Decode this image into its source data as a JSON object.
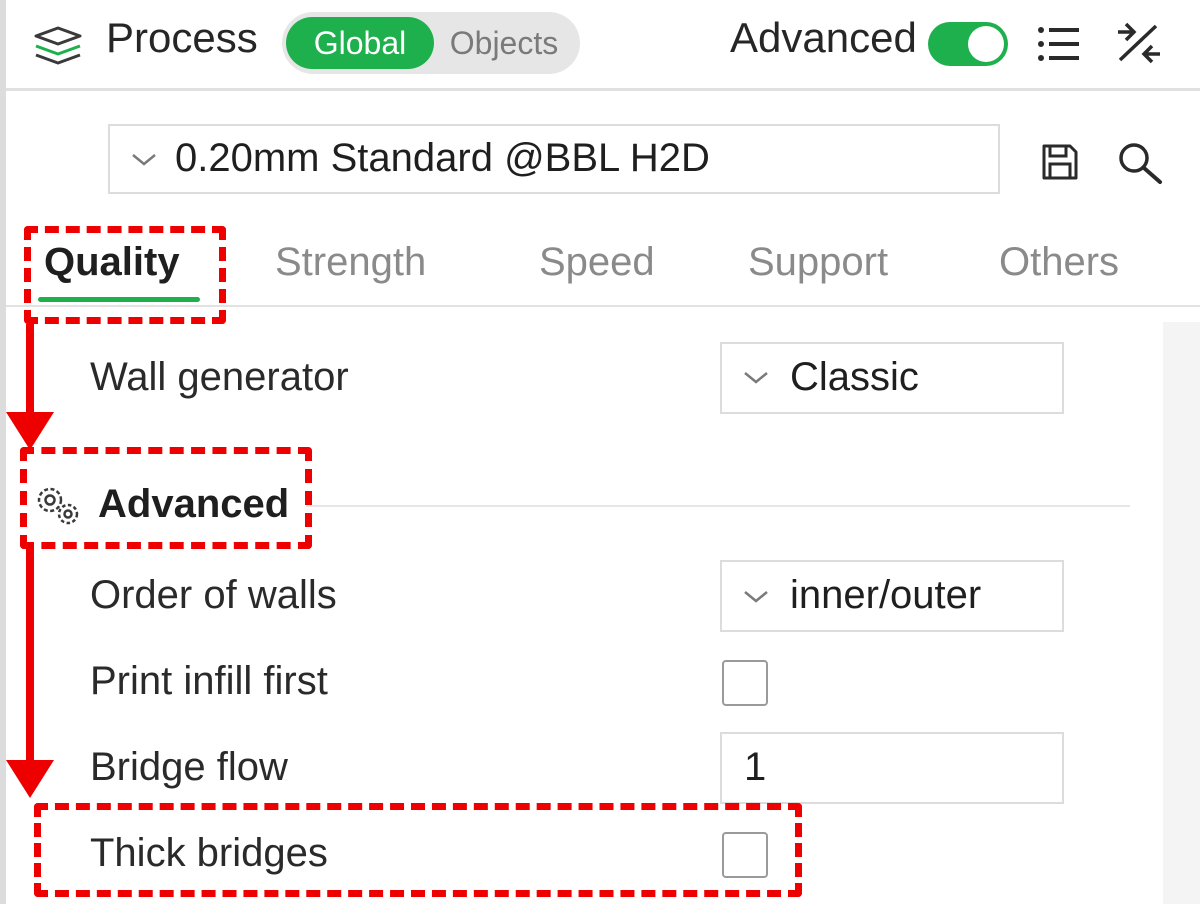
{
  "header": {
    "title": "Process",
    "segment": {
      "global_label": "Global",
      "objects_label": "Objects",
      "selected": "Global"
    },
    "advanced_label": "Advanced",
    "advanced_toggle_on": true,
    "icons": [
      "layers-icon",
      "list-icon",
      "collapse-arrows-icon"
    ]
  },
  "preset": {
    "value": "0.20mm Standard @BBL H2D",
    "icons": [
      "save-icon",
      "search-icon"
    ]
  },
  "tabs": [
    {
      "label": "Quality",
      "active": true
    },
    {
      "label": "Strength",
      "active": false
    },
    {
      "label": "Speed",
      "active": false
    },
    {
      "label": "Support",
      "active": false
    },
    {
      "label": "Others",
      "active": false
    }
  ],
  "settings": {
    "wall_generator": {
      "label": "Wall generator",
      "value": "Classic"
    },
    "advanced_section": {
      "title": "Advanced",
      "icon": "gear-icon"
    },
    "order_of_walls": {
      "label": "Order of walls",
      "value": "inner/outer"
    },
    "print_infill_first": {
      "label": "Print infill first",
      "checked": false
    },
    "bridge_flow": {
      "label": "Bridge flow",
      "value": "1"
    },
    "thick_bridges": {
      "label": "Thick bridges",
      "checked": false
    }
  },
  "colors": {
    "accent": "#1fb04e",
    "annotation": "#ee0000"
  }
}
